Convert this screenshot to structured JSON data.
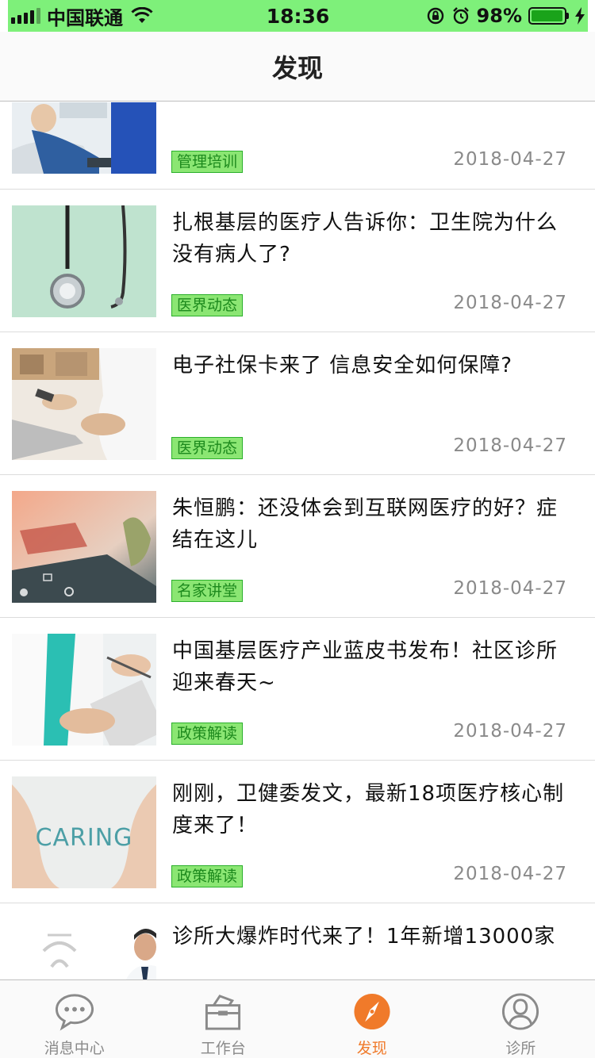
{
  "status_bar": {
    "carrier": "中国联通",
    "time": "18:36",
    "battery_percent": "98%",
    "battery_level": 0.98
  },
  "header": {
    "title": "发现"
  },
  "articles": [
    {
      "title": "",
      "tag": "管理培训",
      "date": "2018-04-27",
      "image": "dental-chair-photo"
    },
    {
      "title": "扎根基层的医疗人告诉你：卫生院为什么没有病人了?",
      "tag": "医界动态",
      "date": "2018-04-27",
      "image": "stethoscope-photo"
    },
    {
      "title": "电子社保卡来了 信息安全如何保障?",
      "tag": "医界动态",
      "date": "2018-04-27",
      "image": "laptop-doctor-photo"
    },
    {
      "title": "朱恒鹏：还没体会到互联网医疗的好？症结在这儿",
      "tag": "名家讲堂",
      "date": "2018-04-27",
      "image": "tablet-icons-photo"
    },
    {
      "title": "中国基层医疗产业蓝皮书发布！社区诊所迎来春天~",
      "tag": "政策解读",
      "date": "2018-04-27",
      "image": "doctor-writing-photo"
    },
    {
      "title": "刚刚，卫健委发文，最新18项医疗核心制度来了！",
      "tag": "政策解读",
      "date": "2018-04-27",
      "image": "caring-hands-photo",
      "image_text": "CARING"
    },
    {
      "title": "诊所大爆炸时代来了！1年新增13000家",
      "tag": "",
      "date": "",
      "image": "doctor-portrait-photo"
    }
  ],
  "tabs": [
    {
      "label": "消息中心",
      "icon": "chat-bubble-icon",
      "active": false
    },
    {
      "label": "工作台",
      "icon": "toolbox-icon",
      "active": false
    },
    {
      "label": "发现",
      "icon": "compass-icon",
      "active": true
    },
    {
      "label": "诊所",
      "icon": "user-circle-icon",
      "active": false
    }
  ],
  "colors": {
    "status_bar_bg": "#7ef07a",
    "tag_bg": "#8be673",
    "tag_text": "#1d8a1d",
    "active_tab": "#f07a2a",
    "inactive_tab": "#8a8a8a"
  }
}
